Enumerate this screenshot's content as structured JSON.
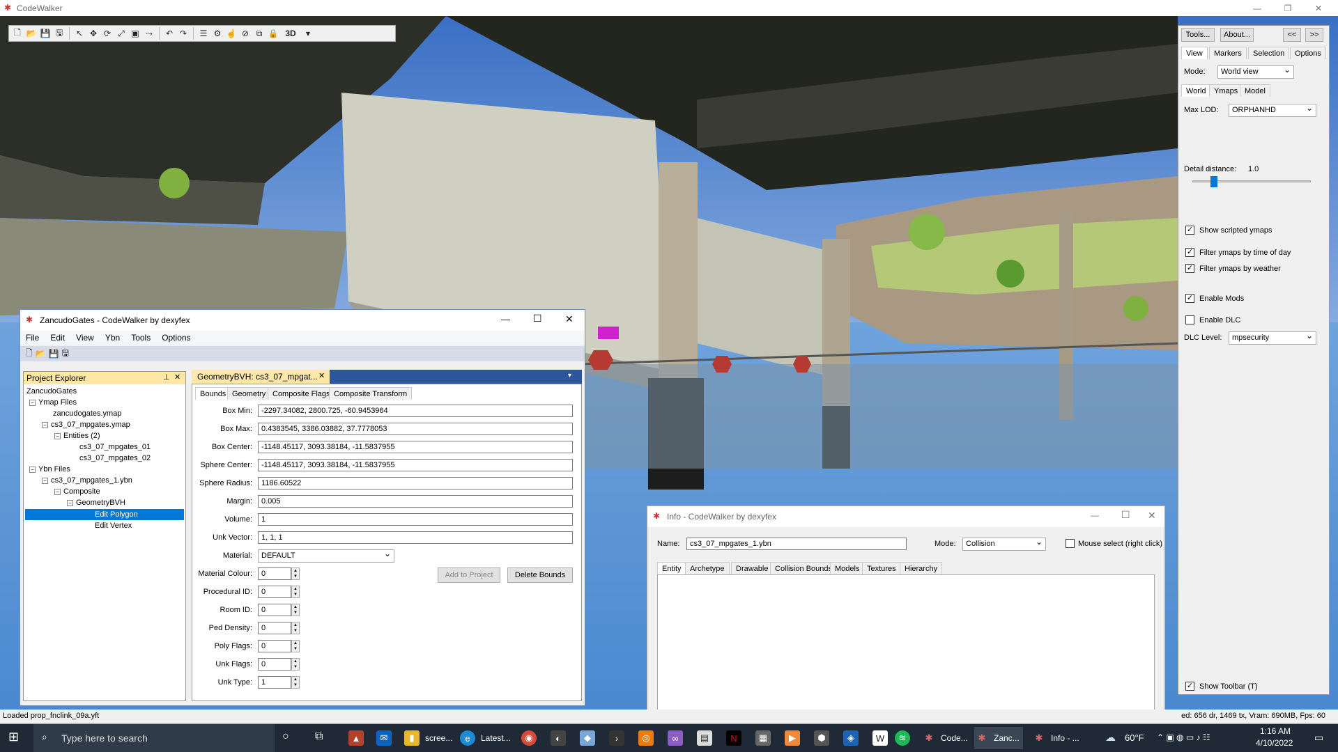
{
  "app": {
    "title": "CodeWalker"
  },
  "status": {
    "left": "Loaded prop_fnclink_09a.yft",
    "right": "ed: 656 dr, 1469 tx, Vram: 690MB, Fps: 60"
  },
  "toolbar": {
    "mode3d": "3D"
  },
  "right_panel": {
    "tools_label": "Tools...",
    "about_label": "About...",
    "prev_label": "<<",
    "next_label": ">>",
    "tabs": [
      "View",
      "Markers",
      "Selection",
      "Options"
    ],
    "mode_label": "Mode:",
    "mode_value": "World view",
    "subtabs": [
      "World",
      "Ymaps",
      "Model"
    ],
    "maxlod_label": "Max LOD:",
    "maxlod_value": "ORPHANHD",
    "detail_label": "Detail distance:",
    "detail_value": "1.0",
    "detail_slider_fraction": 0.18,
    "checks": [
      {
        "label": "Show scripted ymaps",
        "checked": true
      },
      {
        "label": "Filter ymaps by time of day",
        "checked": true
      },
      {
        "label": "Filter ymaps by weather",
        "checked": true
      },
      {
        "label": "Enable Mods",
        "checked": true
      },
      {
        "label": "Enable DLC",
        "checked": false
      }
    ],
    "dlc_label": "DLC Level:",
    "dlc_value": "mpsecurity",
    "show_toolbar": "Show Toolbar (T)"
  },
  "project": {
    "title": "ZancudoGates - CodeWalker by dexyfex",
    "menu": [
      "File",
      "Edit",
      "View",
      "Ybn",
      "Tools",
      "Options"
    ],
    "explorer_title": "Project Explorer",
    "tree": [
      "ZancudoGates",
      "Ymap Files",
      "zancudogates.ymap",
      "cs3_07_mpgates.ymap",
      "Entities (2)",
      "cs3_07_mpgates_01",
      "cs3_07_mpgates_02",
      "Ybn Files",
      "cs3_07_mpgates_1.ybn",
      "Composite",
      "GeometryBVH",
      "Edit Polygon",
      "Edit Vertex"
    ],
    "doc_tab": "GeometryBVH: cs3_07_mpgat...",
    "subtabs": [
      "Bounds",
      "Geometry",
      "Composite Flags",
      "Composite Transform"
    ],
    "fields": [
      {
        "label": "Box Min:",
        "value": "-2297.34082, 2800.725, -60.9453964"
      },
      {
        "label": "Box Max:",
        "value": "0.4383545, 3386.03882, 37.7778053"
      },
      {
        "label": "Box Center:",
        "value": "-1148.45117, 3093.38184, -11.5837955"
      },
      {
        "label": "Sphere Center:",
        "value": "-1148.45117, 3093.38184, -11.5837955"
      },
      {
        "label": "Sphere Radius:",
        "value": "1186.60522"
      },
      {
        "label": "Margin:",
        "value": "0.005"
      },
      {
        "label": "Volume:",
        "value": "1"
      },
      {
        "label": "Unk Vector:",
        "value": "1, 1, 1"
      }
    ],
    "material_label": "Material:",
    "material_value": "DEFAULT",
    "add_label": "Add to Project",
    "delete_label": "Delete Bounds",
    "spins": [
      {
        "label": "Material Colour:",
        "value": "0"
      },
      {
        "label": "Procedural ID:",
        "value": "0"
      },
      {
        "label": "Room ID:",
        "value": "0"
      },
      {
        "label": "Ped Density:",
        "value": "0"
      },
      {
        "label": "Poly Flags:",
        "value": "0"
      },
      {
        "label": "Unk Flags:",
        "value": "0"
      },
      {
        "label": "Unk Type:",
        "value": "1"
      }
    ]
  },
  "info": {
    "title": "Info - CodeWalker by dexyfex",
    "name_label": "Name:",
    "name_value": "cs3_07_mpgates_1.ybn",
    "mode_label": "Mode:",
    "mode_value": "Collision",
    "mouse_select": "Mouse select (right click)",
    "tabs": [
      "Entity",
      "Archetype",
      "Drawable",
      "Collision Bounds",
      "Models",
      "Textures",
      "Hierarchy"
    ]
  },
  "taskbar": {
    "search": "Type here to search",
    "apps": [
      "scree...",
      "Latest...",
      "Code...",
      "Zanc...",
      "Info - ..."
    ],
    "weather": "60°F",
    "time": "1:16 AM",
    "date": "4/10/2022"
  }
}
